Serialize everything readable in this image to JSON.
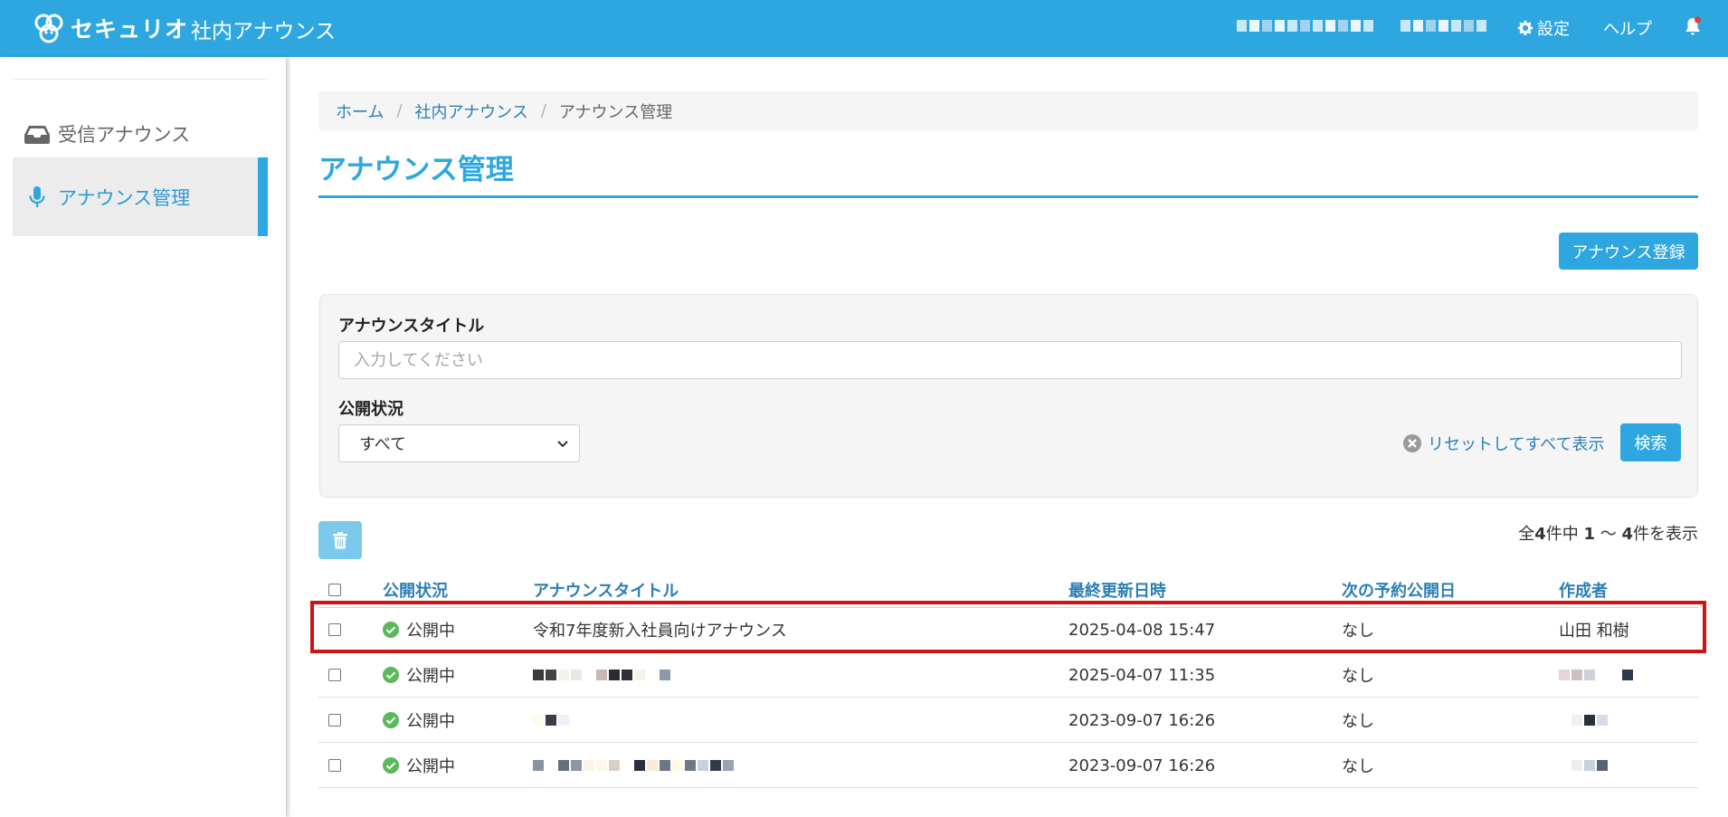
{
  "header": {
    "logo_text": "セキュリオ",
    "app_title": "社内アナウンス",
    "settings_label": "設定",
    "help_label": "ヘルプ"
  },
  "sidebar": {
    "items": [
      {
        "label": "受信アナウンス",
        "icon": "inbox-icon",
        "active": false
      },
      {
        "label": "アナウンス管理",
        "icon": "microphone-icon",
        "active": true
      }
    ]
  },
  "breadcrumb": {
    "home": "ホーム",
    "section": "社内アナウンス",
    "current": "アナウンス管理"
  },
  "page": {
    "title": "アナウンス管理",
    "register_button": "アナウンス登録"
  },
  "search": {
    "title_label": "アナウンスタイトル",
    "title_value": "",
    "title_placeholder": "入力してください",
    "status_label": "公開状況",
    "status_selected": "すべて",
    "reset_label": "リセットしてすべて表示",
    "search_button": "検索"
  },
  "result_count": {
    "prefix": "全",
    "total": "4",
    "mid": "件中",
    "from": "1",
    "tilde": "〜",
    "to": "4",
    "suffix": "件を表示"
  },
  "table": {
    "columns": [
      "公開状況",
      "アナウンスタイトル",
      "最終更新日時",
      "次の予約公開日",
      "作成者"
    ],
    "rows": [
      {
        "status": "公開中",
        "title": "令和7年度新入社員向けアナウンス",
        "updated": "2025-04-08 15:47",
        "next": "なし",
        "author": "山田 和樹",
        "highlighted": true
      },
      {
        "status": "公開中",
        "title": "",
        "updated": "2025-04-07 11:35",
        "next": "なし",
        "author": ""
      },
      {
        "status": "公開中",
        "title": "",
        "updated": "2023-09-07 16:26",
        "next": "なし",
        "author": ""
      },
      {
        "status": "公開中",
        "title": "",
        "updated": "2023-09-07 16:26",
        "next": "なし",
        "author": ""
      }
    ]
  },
  "colors": {
    "brand": "#2ea7e0",
    "link": "#2c7fb3",
    "published_green": "#5cb85c",
    "highlight_red": "#cc1515"
  }
}
